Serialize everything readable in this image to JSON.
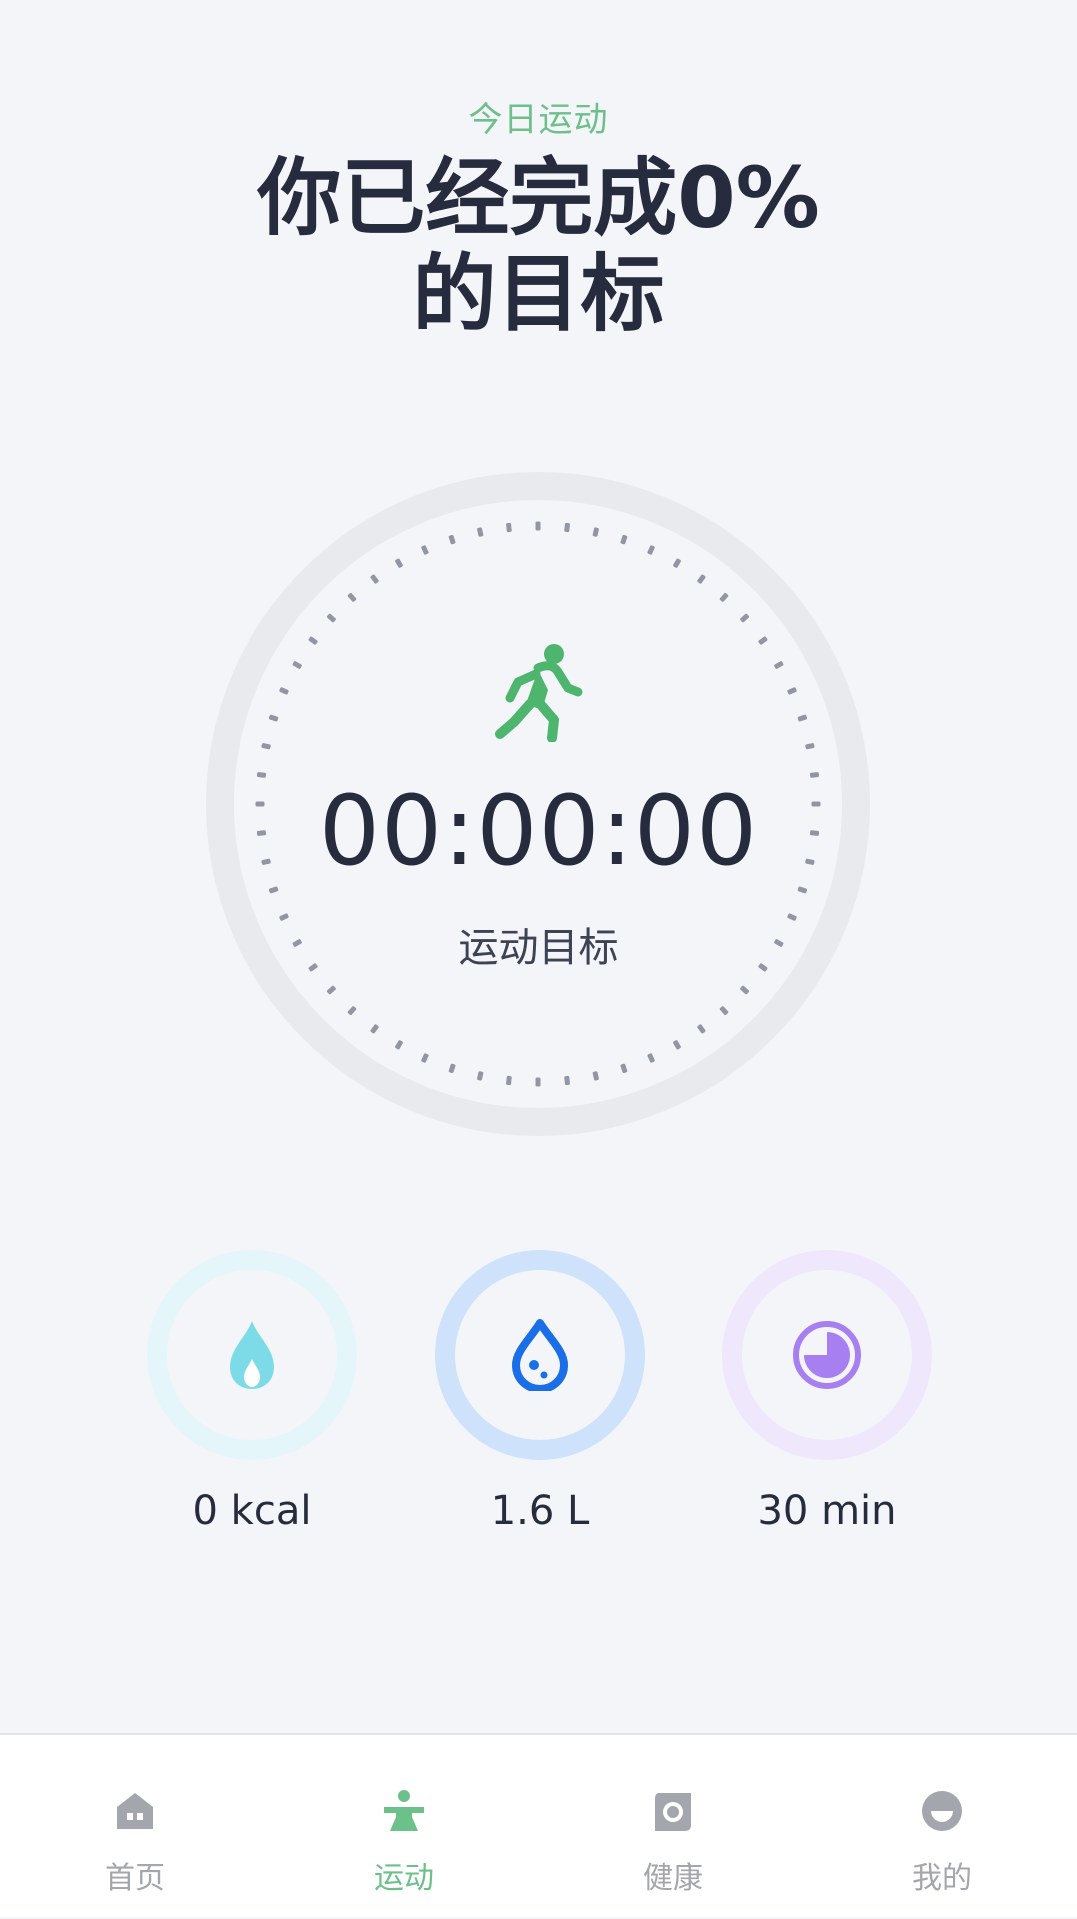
{
  "header": {
    "subtitle": "今日运动",
    "title_line1": "你已经完成0%",
    "title_line2": "的目标"
  },
  "workout": {
    "progress_percent": 0,
    "timer": "00:00:00",
    "goal_label": "运动目标",
    "icon": "walking-person-icon"
  },
  "stats": [
    {
      "value": "0 kcal",
      "icon": "flame-icon",
      "color": "#7ddbe8"
    },
    {
      "value": "1.6 L",
      "icon": "water-drop-icon",
      "color": "#1a6ee8"
    },
    {
      "value": "30 min",
      "icon": "clock-icon",
      "color": "#a77ff0"
    }
  ],
  "tabbar": {
    "active": "运动",
    "accent_color": "#6cc08a",
    "items": [
      {
        "label": "首页",
        "icon": "home-icon"
      },
      {
        "label": "运动",
        "icon": "sport-icon"
      },
      {
        "label": "健康",
        "icon": "health-icon"
      },
      {
        "label": "我的",
        "icon": "profile-icon"
      }
    ]
  }
}
